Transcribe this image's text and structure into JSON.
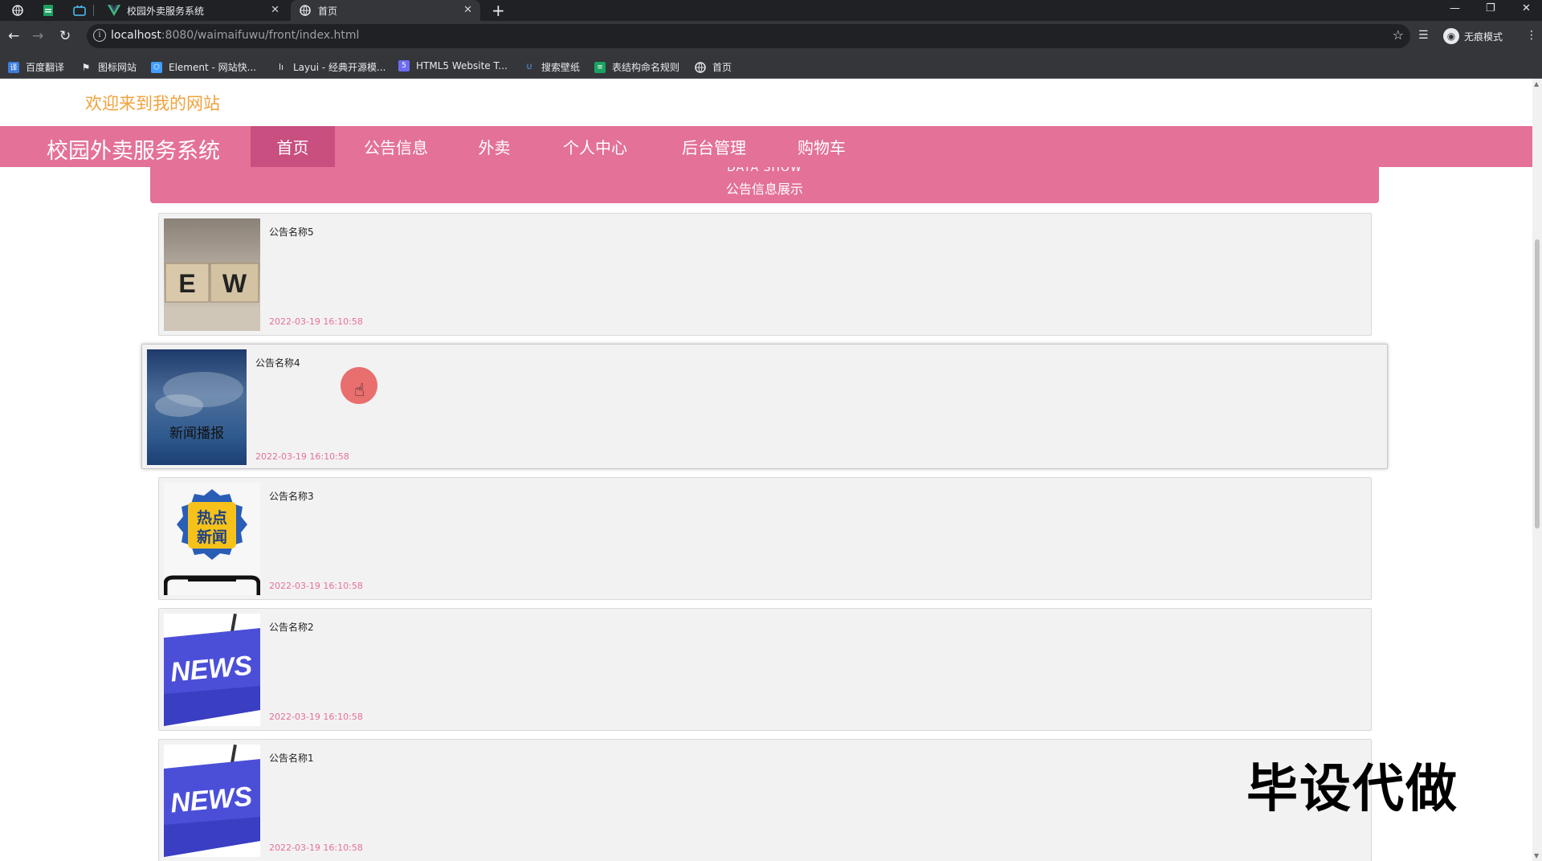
{
  "browser": {
    "tabs": [
      {
        "title": "校园外卖服务系统",
        "icon": "vue-icon"
      },
      {
        "title": "首页",
        "icon": "globe-icon"
      }
    ],
    "url_host": "localhost",
    "url_path": ":8080/waimaifuwu/front/index.html",
    "incognito_label": "无痕模式",
    "bookmarks": [
      {
        "label": "百度翻译"
      },
      {
        "label": "图标网站"
      },
      {
        "label": "Element - 网站快..."
      },
      {
        "label": "Layui - 经典开源模..."
      },
      {
        "label": "HTML5 Website T..."
      },
      {
        "label": "搜索壁纸"
      },
      {
        "label": "表结构命名规则"
      },
      {
        "label": "首页"
      }
    ]
  },
  "site": {
    "welcome": "欢迎来到我的网站",
    "brand": "校园外卖服务系统",
    "nav": [
      "首页",
      "公告信息",
      "外卖",
      "个人中心",
      "后台管理",
      "购物车"
    ],
    "active_nav": "首页",
    "accent_color": "#e47197"
  },
  "section": {
    "title_en": "DATA SHOW",
    "title_cn": "公告信息展示"
  },
  "notices": [
    {
      "title": "公告名称5",
      "date": "2022-03-19 16:10:58",
      "image": "ew-blocks"
    },
    {
      "title": "公告名称4",
      "date": "2022-03-19 16:10:58",
      "image": "news-broadcast",
      "image_text": "新闻播报"
    },
    {
      "title": "公告名称3",
      "date": "2022-03-19 16:10:58",
      "image": "hot-news-badge",
      "image_text": "热点新闻"
    },
    {
      "title": "公告名称2",
      "date": "2022-03-19 16:10:58",
      "image": "news-keycap",
      "image_text": "NEWS"
    },
    {
      "title": "公告名称1",
      "date": "2022-03-19 16:10:58",
      "image": "news-keycap",
      "image_text": "NEWS"
    }
  ],
  "watermark": "毕设代做"
}
